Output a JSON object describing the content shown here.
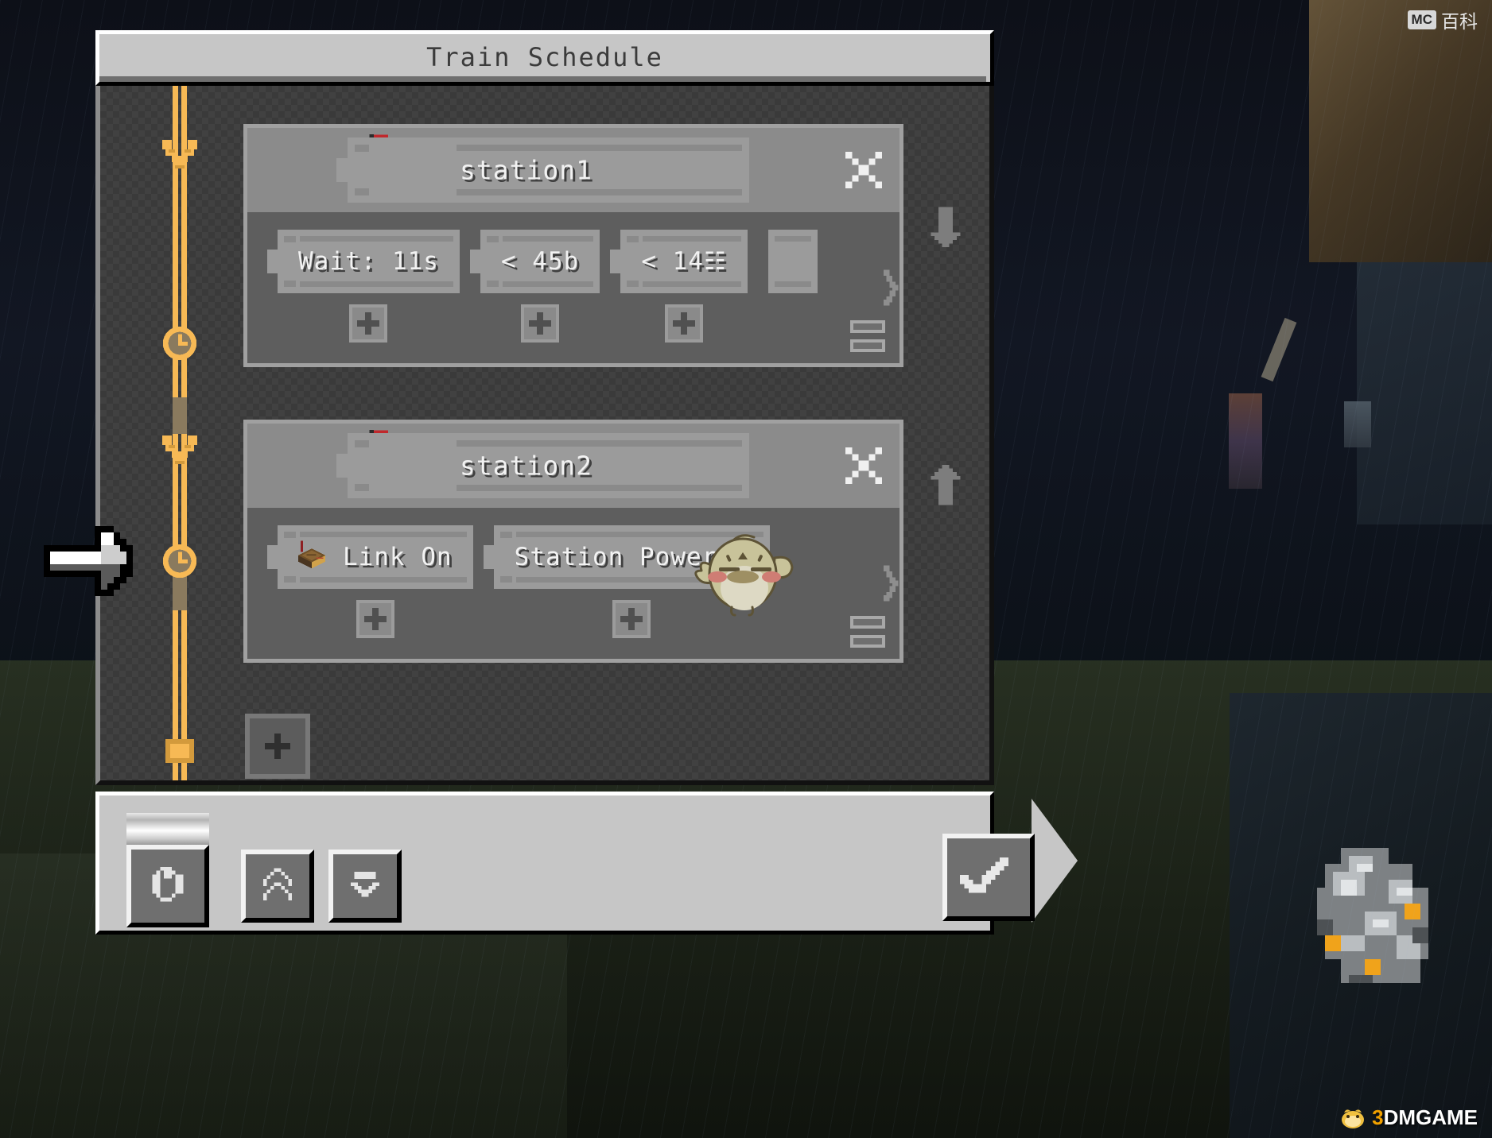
{
  "window": {
    "title": "Train Schedule"
  },
  "entries": [
    {
      "destination": {
        "name": "station1",
        "icon": "train-station-block-icon",
        "close_label": "✕"
      },
      "conditions": [
        {
          "text": "Wait: 11s",
          "icon": null,
          "add_label": "+"
        },
        {
          "text": "< 45b",
          "icon": null,
          "add_label": "+"
        },
        {
          "text": "< 14☷",
          "icon": null,
          "add_label": "+"
        }
      ],
      "has_overflow": true,
      "next_arrow": "▶",
      "list_icon": "condition-list-icon",
      "move_arrow": "down-arrow-icon"
    },
    {
      "destination": {
        "name": "station2",
        "icon": "train-station-block-icon",
        "close_label": "✕"
      },
      "conditions": [
        {
          "text": "Link On",
          "icon": "redstone-link-block-icon",
          "add_label": "+"
        },
        {
          "text": "Station Powered",
          "icon": null,
          "add_label": "+"
        }
      ],
      "has_overflow": false,
      "next_arrow": "▶",
      "list_icon": "condition-list-icon",
      "move_arrow": "up-arrow-icon"
    }
  ],
  "add_entry": {
    "label": "+"
  },
  "toolbar": {
    "cycle_label": "↻",
    "collapse_all_label": "«",
    "expand_one_label": "ˇ",
    "confirm_label": "✓"
  },
  "cursors": {
    "left_indicator": "right-arrow-pointer",
    "mouse": "bird-cursor"
  },
  "watermarks": {
    "top_right_badge": "MC",
    "top_right_text": "百科",
    "bottom_right_num": "3",
    "bottom_right_text": "DMGAME"
  },
  "colors": {
    "rail": "#f7b955",
    "panel": "#8b8b8b",
    "chip": "#9b9b9b",
    "cond_bg": "#5e5e5e",
    "titlebar": "#c6c6c6",
    "text": "#f2f2f2"
  }
}
